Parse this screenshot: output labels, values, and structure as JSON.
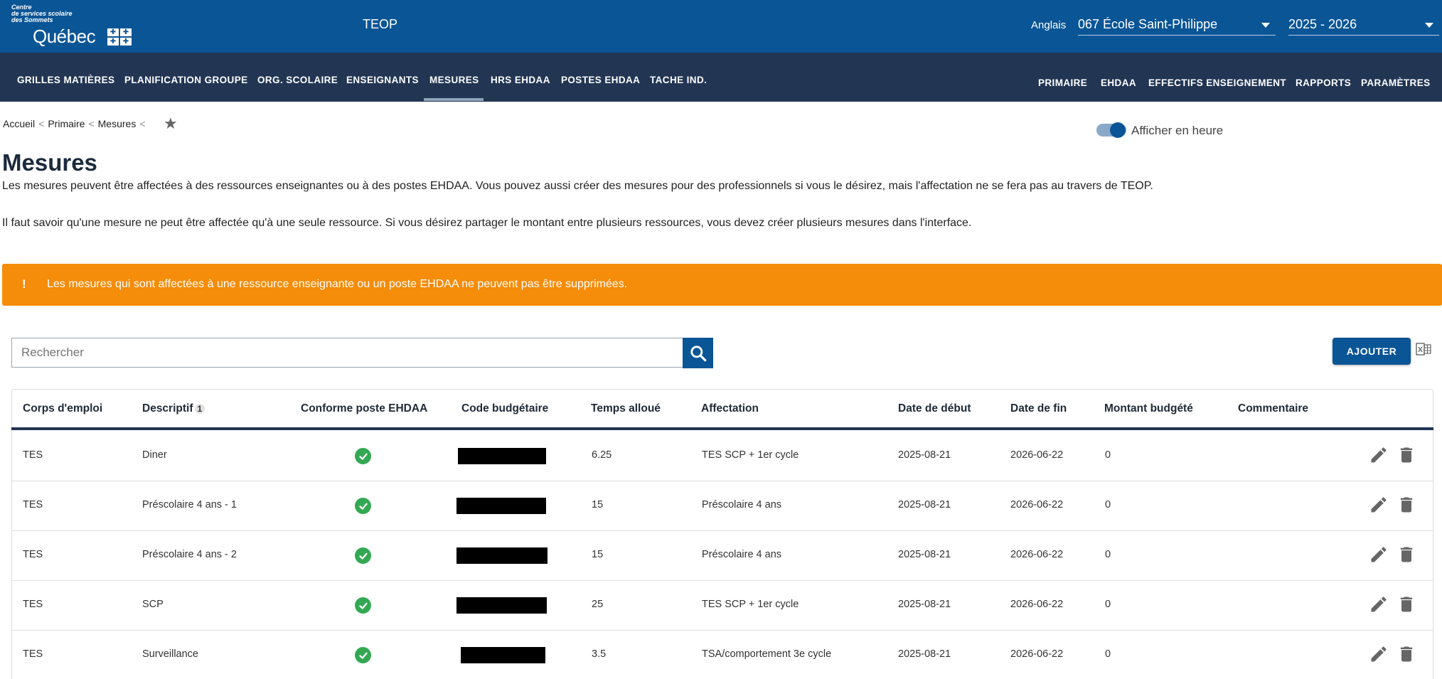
{
  "header": {
    "logo": {
      "line1": "Centre",
      "line2": "de services scolaire",
      "line3": "des Sommets",
      "name": "Québec"
    },
    "app_name": "TEOP",
    "language_label": "Anglais",
    "school_select": "067 École Saint-Philippe",
    "year_select": "2025 - 2026"
  },
  "nav": {
    "left": [
      "GRILLES MATIÈRES",
      "PLANIFICATION GROUPE",
      "ORG. SCOLAIRE",
      "ENSEIGNANTS",
      "MESURES",
      "HRS EHDAA",
      "POSTES EHDAA",
      "TACHE IND."
    ],
    "right": [
      "PRIMAIRE",
      "EHDAA",
      "EFFECTIFS ENSEIGNEMENT",
      "RAPPORTS",
      "PARAMÈTRES"
    ],
    "active": "MESURES"
  },
  "breadcrumb": [
    "Accueil",
    "Primaire",
    "Mesures"
  ],
  "toggle_label": "Afficher en heure",
  "page_title": "Mesures",
  "description_1": "Les mesures peuvent être affectées à des ressources enseignantes ou à des postes EHDAA. Vous pouvez aussi créer des mesures pour des professionnels si vous le désirez, mais l'affectation ne se fera pas au travers de TEOP.",
  "description_2": "Il faut savoir qu'une mesure ne peut être affectée qu'à une seule ressource. Si vous désirez partager le montant entre plusieurs ressources, vous devez créer plusieurs mesures dans l'interface.",
  "warning": {
    "icon": "!",
    "text": "Les mesures qui sont affectées à une ressource enseignante ou un poste EHDAA ne peuvent pas être supprimées.",
    "color": "#f58c0a"
  },
  "search": {
    "placeholder": "Rechercher"
  },
  "add_label": "AJOUTER",
  "table": {
    "headers": {
      "corps": "Corps d'emploi",
      "descriptif": "Descriptif",
      "descriptif_badge": "1",
      "conforme": "Conforme poste EHDAA",
      "code": "Code budgétaire",
      "temps": "Temps alloué",
      "affectation": "Affectation",
      "debut": "Date de début",
      "fin": "Date de fin",
      "montant": "Montant budgété",
      "commentaire": "Commentaire"
    },
    "rows": [
      {
        "corps": "TES",
        "descriptif": "Diner",
        "temps": "6.25",
        "affectation": "TES SCP + 1er cycle",
        "debut": "2025-08-21",
        "fin": "2026-06-22",
        "montant": "0"
      },
      {
        "corps": "TES",
        "descriptif": "Préscolaire 4 ans - 1",
        "temps": "15",
        "affectation": "Préscolaire 4 ans",
        "debut": "2025-08-21",
        "fin": "2026-06-22",
        "montant": "0"
      },
      {
        "corps": "TES",
        "descriptif": "Préscolaire 4 ans - 2",
        "temps": "15",
        "affectation": "Préscolaire 4 ans",
        "debut": "2025-08-21",
        "fin": "2026-06-22",
        "montant": "0"
      },
      {
        "corps": "TES",
        "descriptif": "SCP",
        "temps": "25",
        "affectation": "TES SCP + 1er cycle",
        "debut": "2025-08-21",
        "fin": "2026-06-22",
        "montant": "0"
      },
      {
        "corps": "TES",
        "descriptif": "Surveillance",
        "temps": "3.5",
        "affectation": "TSA/comportement 3e cycle",
        "debut": "2025-08-21",
        "fin": "2026-06-22",
        "montant": "0"
      }
    ]
  },
  "colors": {
    "header_blue": "#095596",
    "nav_dark": "#223654",
    "check_green": "#33a853"
  }
}
